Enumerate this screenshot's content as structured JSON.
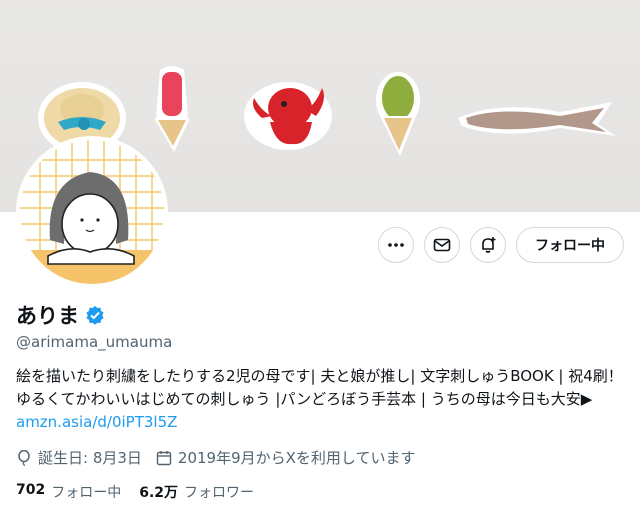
{
  "profile": {
    "display_name": "ありま",
    "handle": "@arimama_umauma",
    "verified": true,
    "bio_lines": [
      "絵を描いたり刺繍をしたりする2児の母です| 夫と娘が推し| 文字刺しゅうBOOK | 祝4刷！",
      "ゆるくてかわいいはじめての刺しゅう |パンどろぼう手芸本 | うちの母は今日も大安▶"
    ],
    "bio_link": "amzn.asia/d/0iPT3l5Z",
    "birthday": "誕生日: 8月3日",
    "joined": "2019年9月からXを利用しています",
    "following_count": "702",
    "following_label": "フォロー中",
    "followers_count": "6.2万",
    "followers_label": "フォロワー"
  },
  "actions": {
    "more_icon": "more-icon",
    "message_icon": "mail-icon",
    "notify_icon": "bell-plus-icon",
    "follow_label": "フォロー中"
  },
  "colors": {
    "link": "#1d9bf0",
    "verified": "#1d9bf0",
    "muted": "#536471",
    "border": "#cfd9de"
  }
}
